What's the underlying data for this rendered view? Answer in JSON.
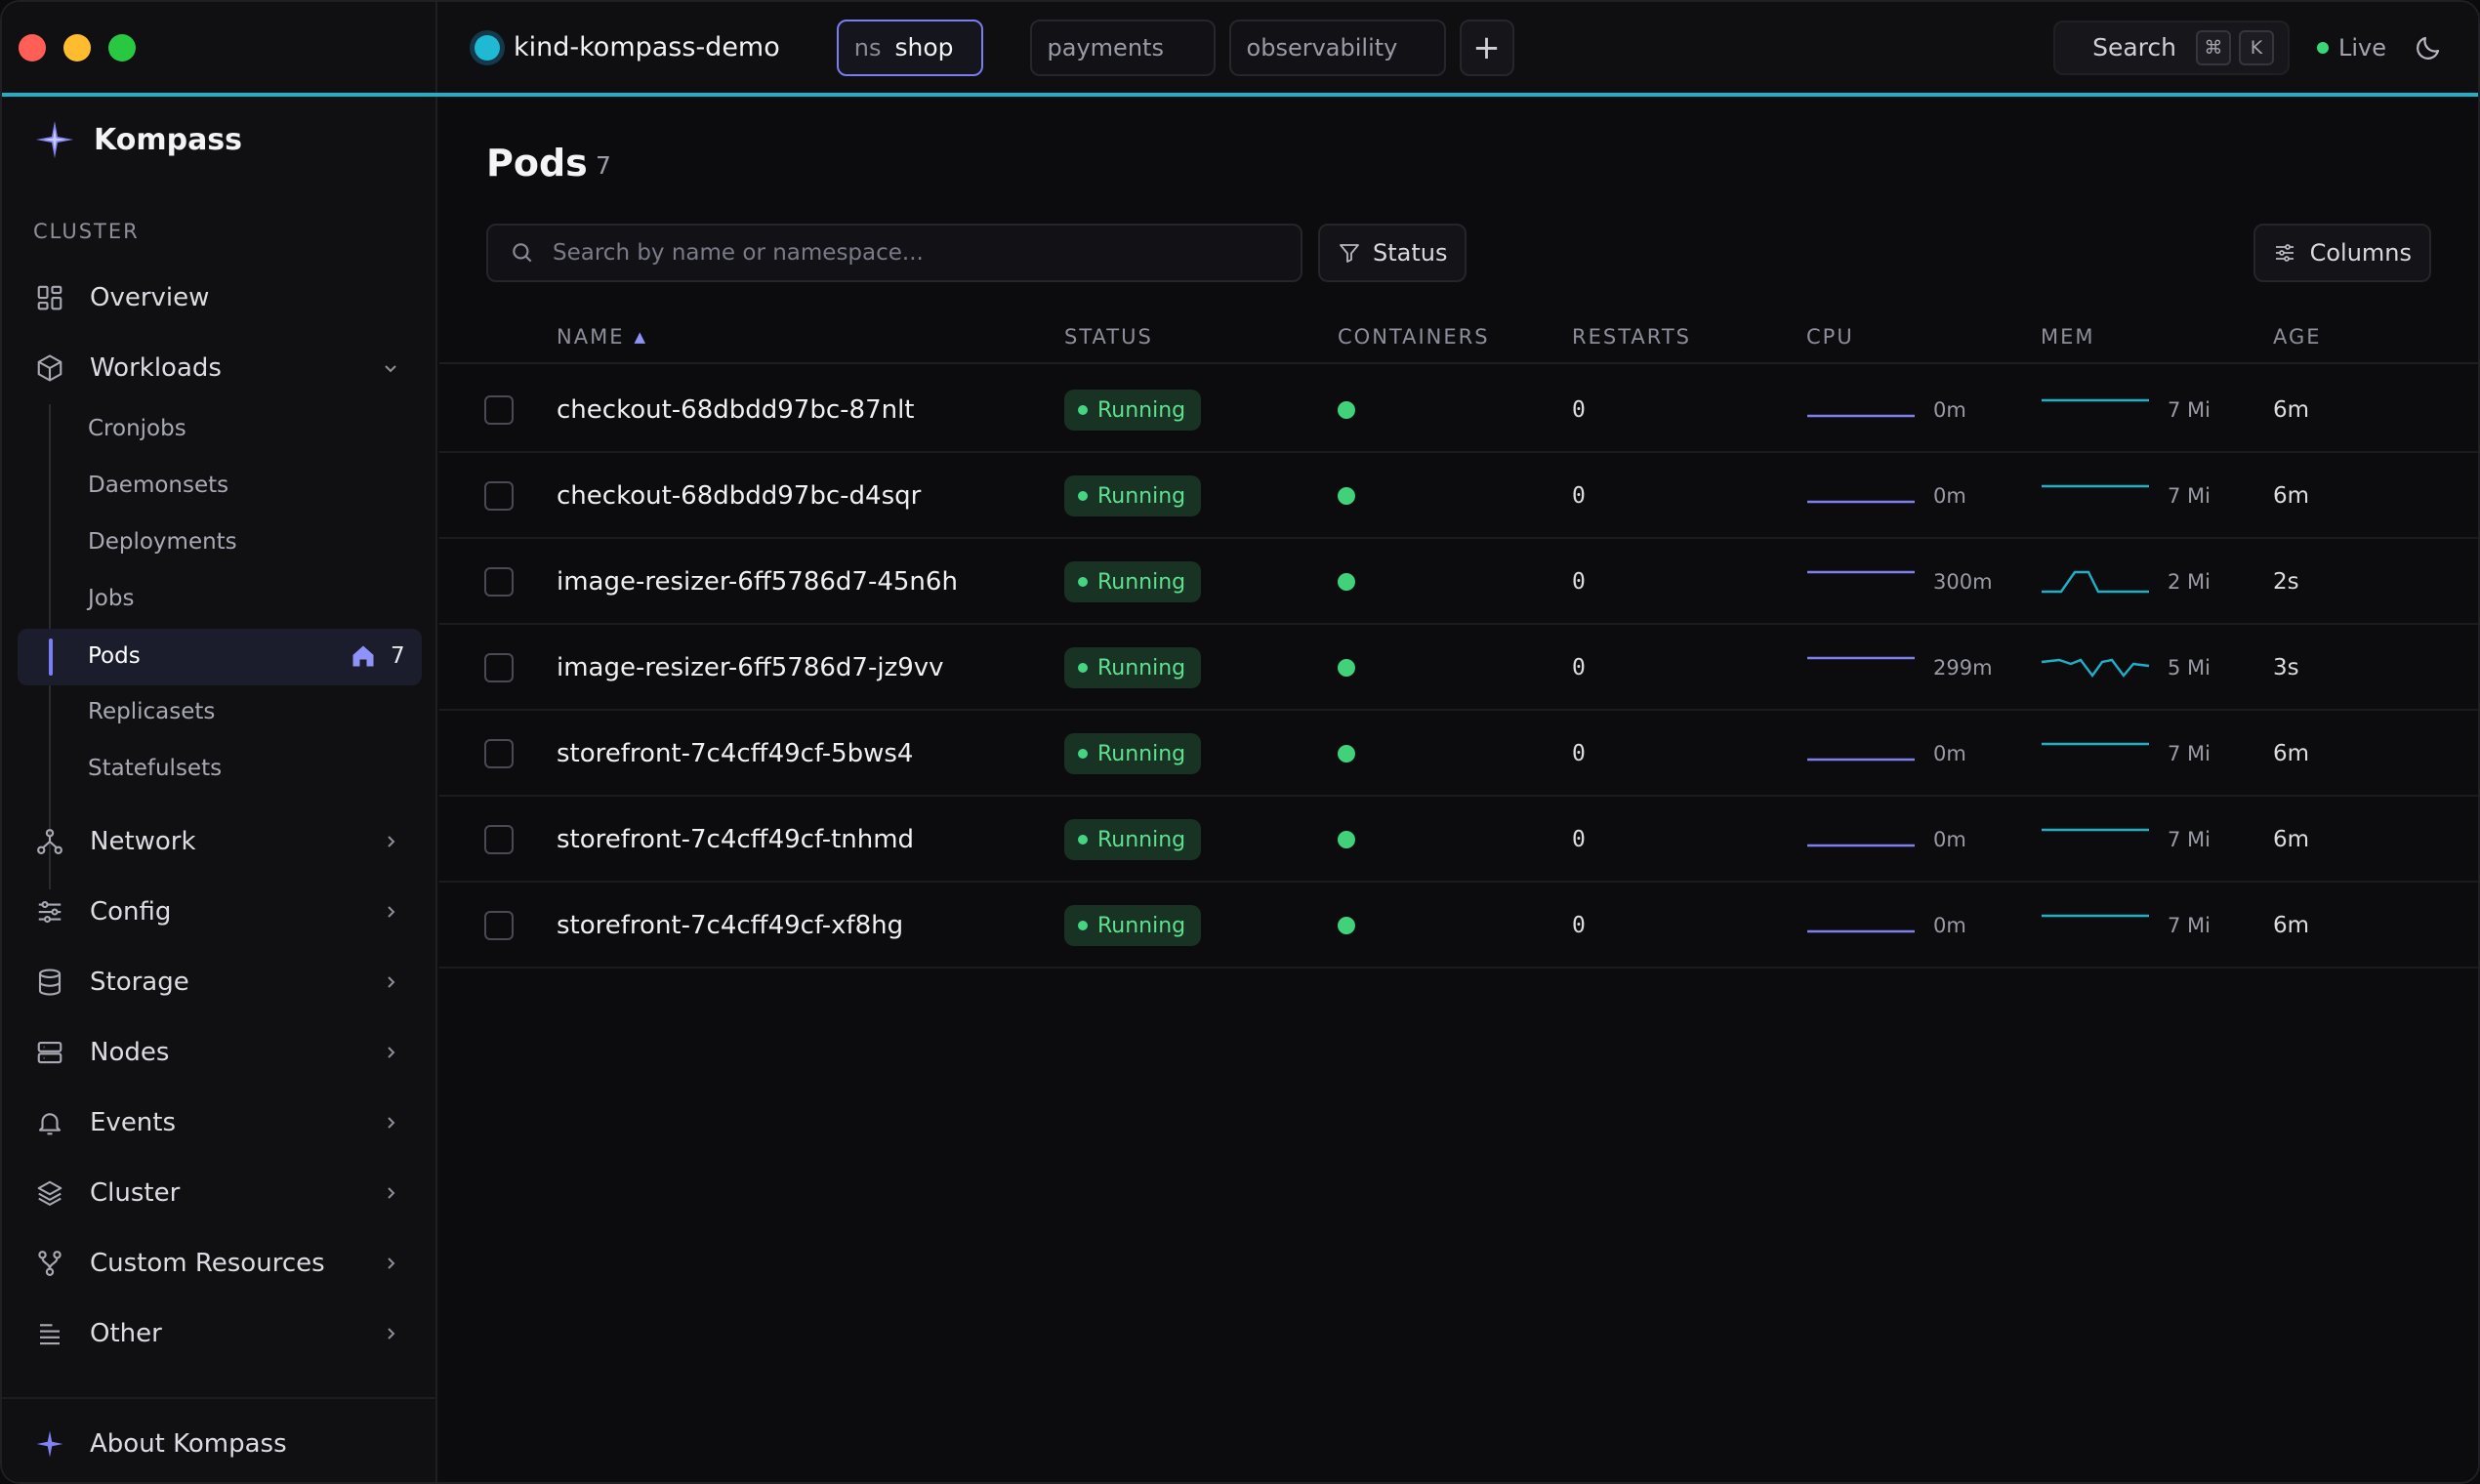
{
  "topbar": {
    "context": "kind-kompass-demo",
    "namespace_prefix": "ns",
    "namespace_active": "shop",
    "namespace_tabs": [
      "payments",
      "observability"
    ],
    "add_label": "+",
    "search_label": "Search",
    "search_keys": [
      "⌘",
      "K"
    ],
    "live_label": "Live"
  },
  "sidebar": {
    "brand": "Kompass",
    "section": "CLUSTER",
    "overview": "Overview",
    "workloads": "Workloads",
    "workload_items": [
      "Cronjobs",
      "Daemonsets",
      "Deployments",
      "Jobs",
      "Pods",
      "Replicasets",
      "Statefulsets"
    ],
    "active_item": "Pods",
    "active_count": "7",
    "groups": [
      "Network",
      "Config",
      "Storage",
      "Nodes",
      "Events",
      "Cluster",
      "Custom Resources",
      "Other"
    ],
    "footer": "About Kompass"
  },
  "main": {
    "title": "Pods",
    "count": "7",
    "search_placeholder": "Search by name or namespace...",
    "status_filter": "Status",
    "columns_button": "Columns",
    "headers": {
      "name": "NAME",
      "sort_indicator": "▲",
      "status": "STATUS",
      "containers": "CONTAINERS",
      "restarts": "RESTARTS",
      "cpu": "CPU",
      "mem": "MEM",
      "age": "AGE"
    },
    "rows": [
      {
        "name": "checkout-68dbdd97bc-87nlt",
        "status": "Running",
        "restarts": "0",
        "cpu": "0m",
        "mem": "7 Mi",
        "age": "6m"
      },
      {
        "name": "checkout-68dbdd97bc-d4sqr",
        "status": "Running",
        "restarts": "0",
        "cpu": "0m",
        "mem": "7 Mi",
        "age": "6m"
      },
      {
        "name": "image-resizer-6ff5786d7-45n6h",
        "status": "Running",
        "restarts": "0",
        "cpu": "300m",
        "mem": "2 Mi",
        "age": "2s"
      },
      {
        "name": "image-resizer-6ff5786d7-jz9vv",
        "status": "Running",
        "restarts": "0",
        "cpu": "299m",
        "mem": "5 Mi",
        "age": "3s"
      },
      {
        "name": "storefront-7c4cff49cf-5bws4",
        "status": "Running",
        "restarts": "0",
        "cpu": "0m",
        "mem": "7 Mi",
        "age": "6m"
      },
      {
        "name": "storefront-7c4cff49cf-tnhmd",
        "status": "Running",
        "restarts": "0",
        "cpu": "0m",
        "mem": "7 Mi",
        "age": "6m"
      },
      {
        "name": "storefront-7c4cff49cf-xf8hg",
        "status": "Running",
        "restarts": "0",
        "cpu": "0m",
        "mem": "7 Mi",
        "age": "6m"
      }
    ]
  },
  "colors": {
    "accent": "#7b7ef2",
    "cpu_line": "#7f7ff0",
    "mem_line": "#1fb0c8",
    "running": "#45d482",
    "topbar_border": "#1fb0c8"
  }
}
